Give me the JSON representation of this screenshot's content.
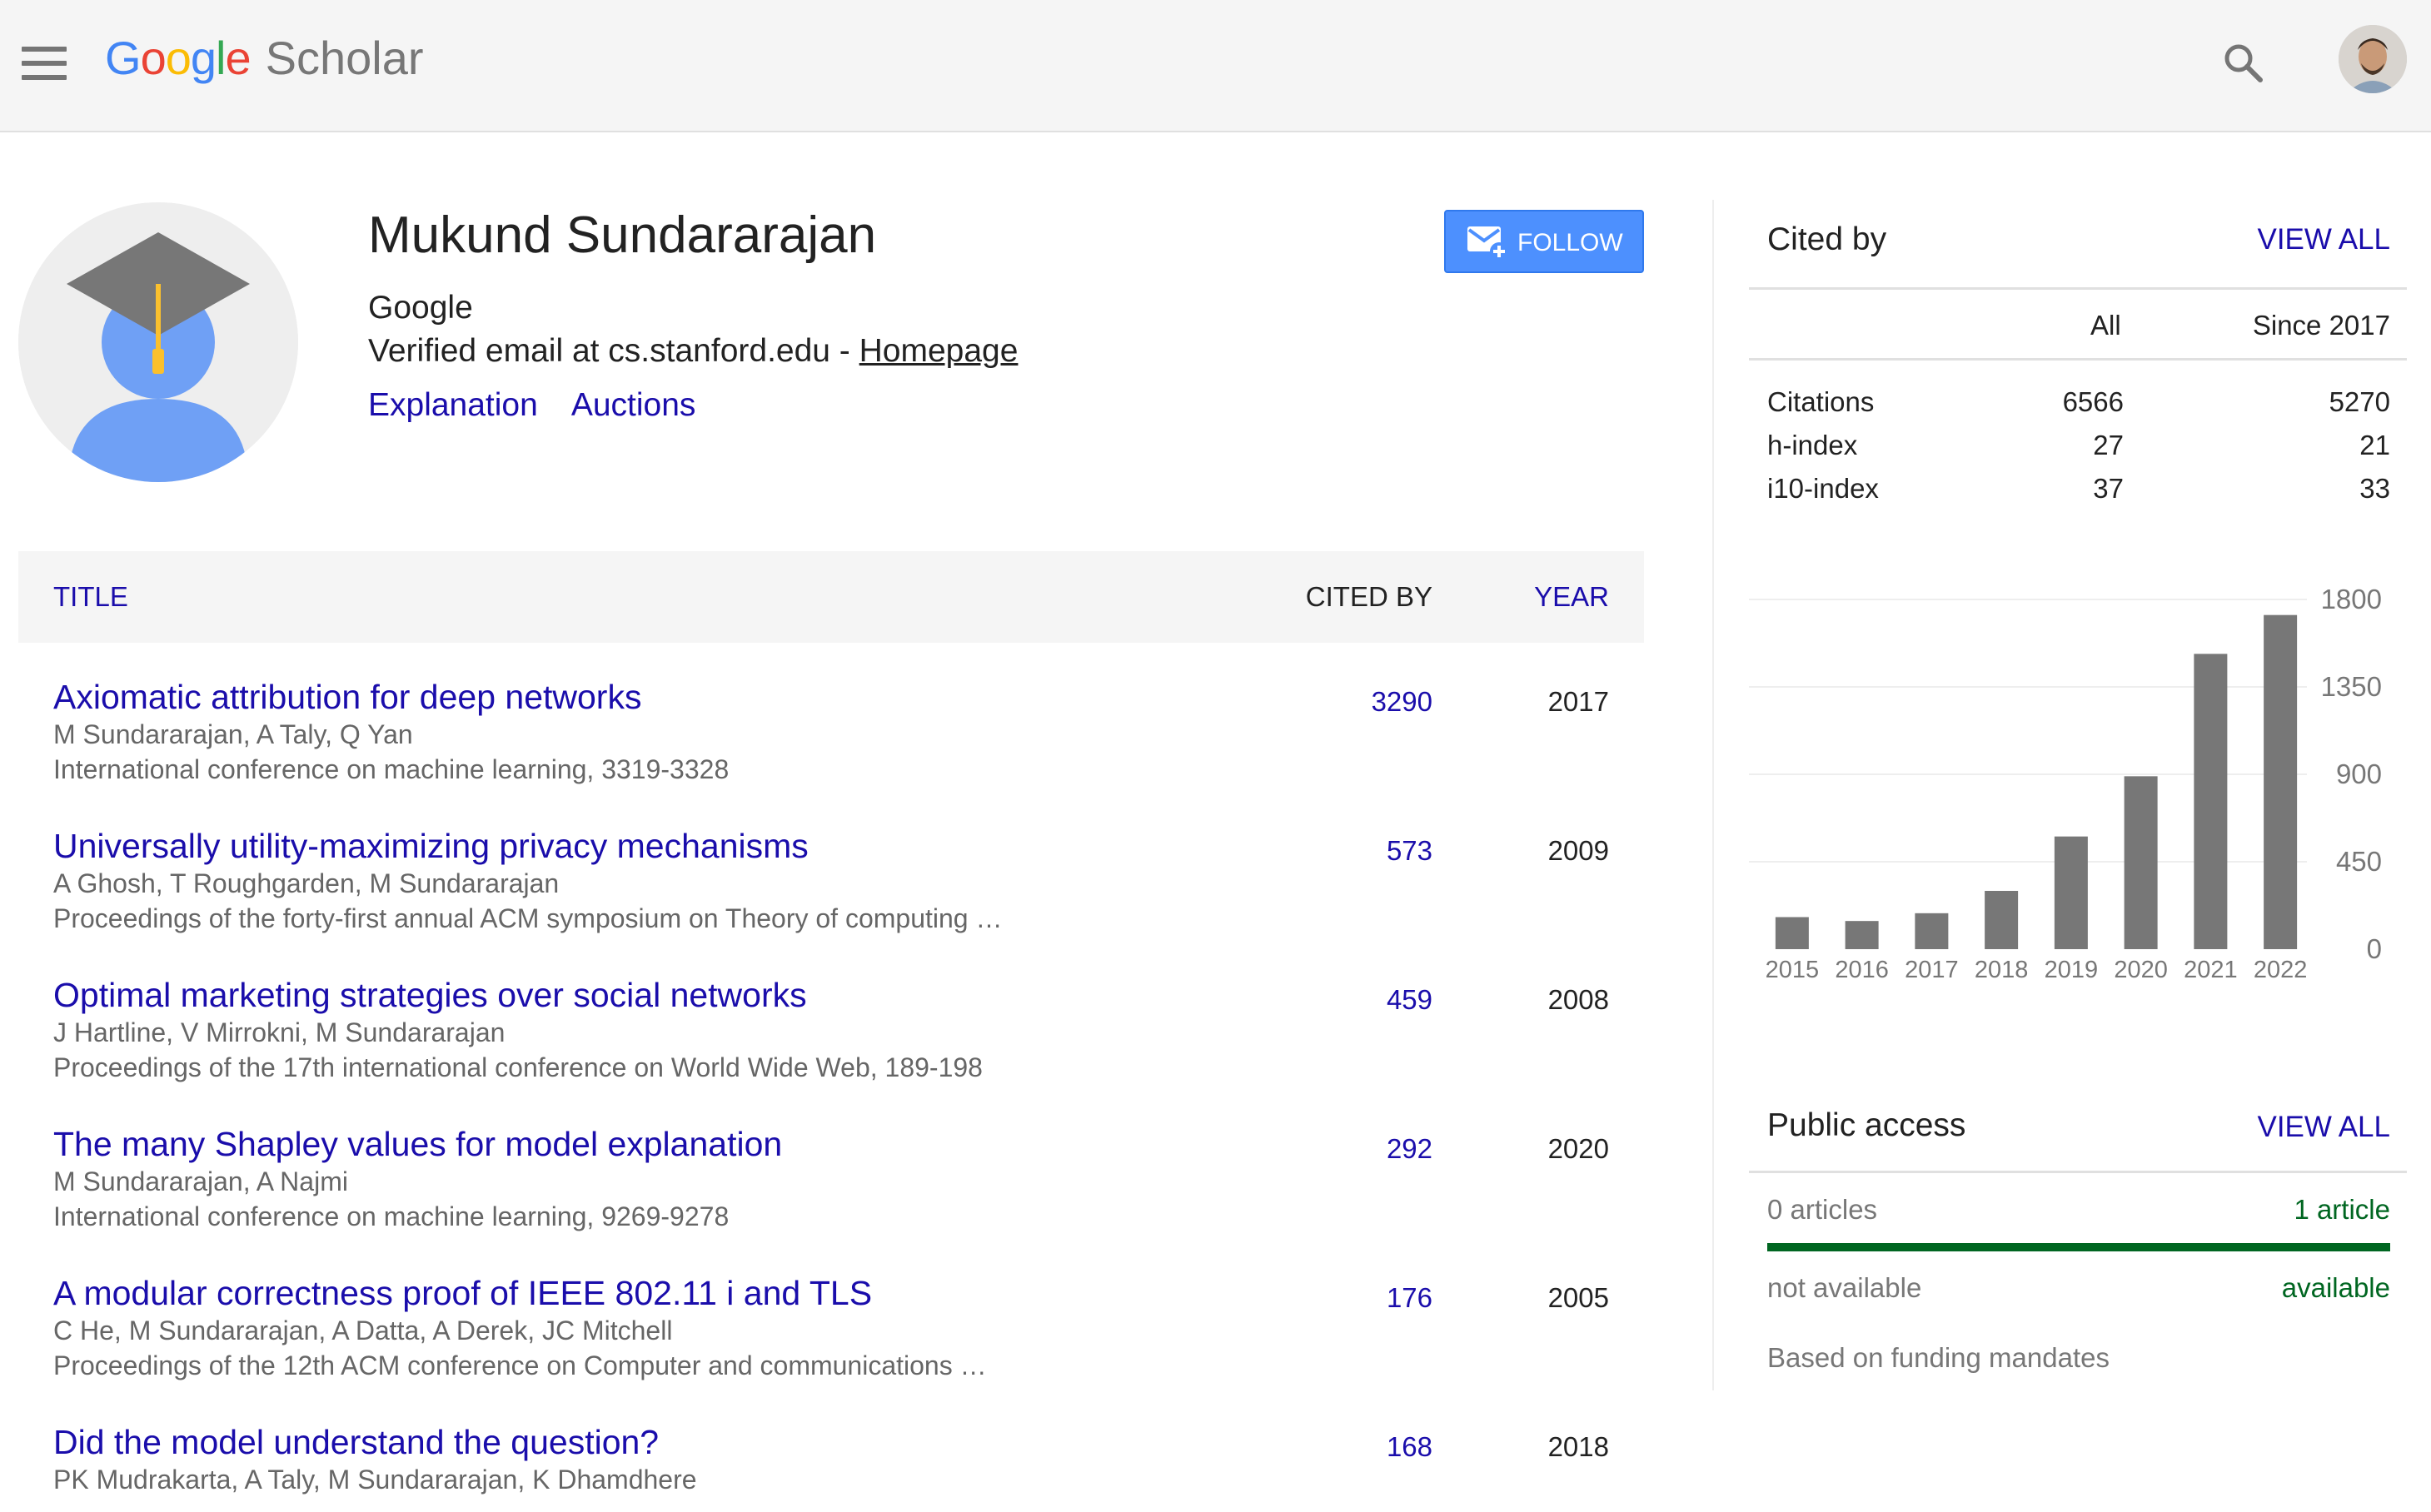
{
  "header": {
    "logo_google_letters": [
      "G",
      "o",
      "o",
      "g",
      "l",
      "e"
    ],
    "logo_scholar": "Scholar"
  },
  "profile": {
    "name": "Mukund Sundararajan",
    "affiliation": "Google",
    "email_text": "Verified email at cs.stanford.edu - ",
    "homepage_label": "Homepage",
    "interests": [
      "Explanation",
      "Auctions"
    ],
    "follow_label": "FOLLOW"
  },
  "articles_table": {
    "headers": {
      "title": "TITLE",
      "cited_by": "CITED BY",
      "year": "YEAR"
    },
    "rows": [
      {
        "title": "Axiomatic attribution for deep networks",
        "authors": "M Sundararajan, A Taly, Q Yan",
        "venue": "International conference on machine learning, 3319-3328",
        "cited_by": "3290",
        "year": "2017"
      },
      {
        "title": "Universally utility-maximizing privacy mechanisms",
        "authors": "A Ghosh, T Roughgarden, M Sundararajan",
        "venue": "Proceedings of the forty-first annual ACM symposium on Theory of computing …",
        "cited_by": "573",
        "year": "2009"
      },
      {
        "title": "Optimal marketing strategies over social networks",
        "authors": "J Hartline, V Mirrokni, M Sundararajan",
        "venue": "Proceedings of the 17th international conference on World Wide Web, 189-198",
        "cited_by": "459",
        "year": "2008"
      },
      {
        "title": "The many Shapley values for model explanation",
        "authors": "M Sundararajan, A Najmi",
        "venue": "International conference on machine learning, 9269-9278",
        "cited_by": "292",
        "year": "2020"
      },
      {
        "title": "A modular correctness proof of IEEE 802.11 i and TLS",
        "authors": "C He, M Sundararajan, A Datta, A Derek, JC Mitchell",
        "venue": "Proceedings of the 12th ACM conference on Computer and communications …",
        "cited_by": "176",
        "year": "2005"
      },
      {
        "title": "Did the model understand the question?",
        "authors": "PK Mudrakarta, A Taly, M Sundararajan, K Dhamdhere",
        "venue": "",
        "cited_by": "168",
        "year": "2018"
      }
    ]
  },
  "cited_by": {
    "title": "Cited by",
    "view_all": "VIEW ALL",
    "col_all": "All",
    "col_since": "Since 2017",
    "rows": [
      {
        "label": "Citations",
        "all": "6566",
        "since": "5270"
      },
      {
        "label": "h-index",
        "all": "27",
        "since": "21"
      },
      {
        "label": "i10-index",
        "all": "37",
        "since": "33"
      }
    ]
  },
  "chart_data": {
    "type": "bar",
    "categories": [
      "2015",
      "2016",
      "2017",
      "2018",
      "2019",
      "2020",
      "2021",
      "2022"
    ],
    "values": [
      165,
      145,
      185,
      300,
      580,
      890,
      1520,
      1720
    ],
    "ylim": [
      0,
      1800
    ],
    "yticks": [
      "0",
      "450",
      "900",
      "1350",
      "1800"
    ],
    "bar_color": "#777777"
  },
  "public_access": {
    "title": "Public access",
    "view_all": "VIEW ALL",
    "left_count": "0 articles",
    "right_count": "1 article",
    "left_status": "not available",
    "right_status": "available",
    "note": "Based on funding mandates",
    "available_color": "#006621"
  }
}
